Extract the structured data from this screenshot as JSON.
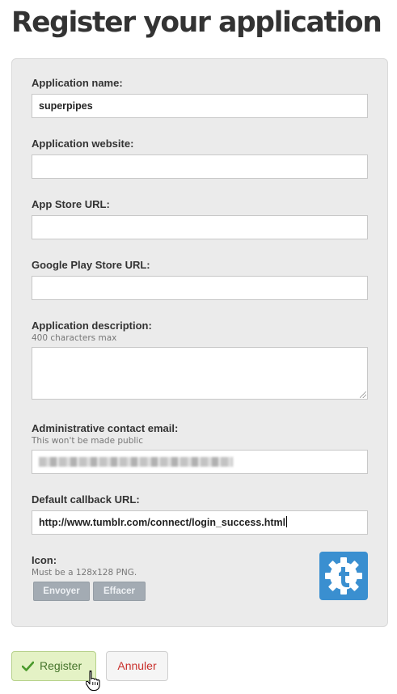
{
  "page": {
    "title": "Register your application"
  },
  "form": {
    "app_name": {
      "label": "Application name:",
      "value": "superpipes"
    },
    "app_website": {
      "label": "Application website:",
      "value": ""
    },
    "app_store_url": {
      "label": "App Store URL:",
      "value": ""
    },
    "google_play_url": {
      "label": "Google Play Store URL:",
      "value": ""
    },
    "description": {
      "label": "Application description:",
      "hint": "400 characters max",
      "value": ""
    },
    "contact_email": {
      "label": "Administrative contact email:",
      "hint": "This won't be made public",
      "value": ""
    },
    "callback_url": {
      "label": "Default callback URL:",
      "value": "http://www.tumblr.com/connect/login_success.html"
    },
    "icon": {
      "label": "Icon:",
      "hint": "Must be a 128x128 PNG.",
      "upload_label": "Envoyer",
      "clear_label": "Effacer",
      "icon_name": "tumblr-gear-icon",
      "icon_color": "#3a8fd0"
    }
  },
  "actions": {
    "register_label": "Register",
    "cancel_label": "Annuler",
    "register_color": "#44732a",
    "cancel_color": "#c9302c"
  }
}
